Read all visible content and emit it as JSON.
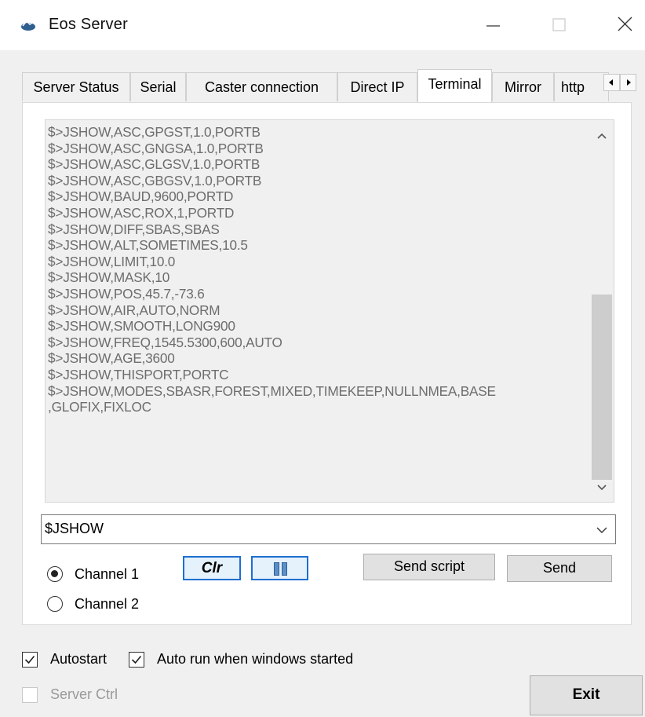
{
  "window": {
    "title": "Eos Server",
    "icon": "eos-app-icon",
    "controls": {
      "minimize": "minimize-icon",
      "maximize": "maximize-icon",
      "close": "close-icon"
    }
  },
  "tabs": [
    {
      "label": "Server Status",
      "active": false
    },
    {
      "label": "Serial",
      "active": false
    },
    {
      "label": "Caster connection",
      "active": false
    },
    {
      "label": "Direct IP",
      "active": false
    },
    {
      "label": "Terminal",
      "active": true
    },
    {
      "label": "Mirror",
      "active": false
    },
    {
      "label": "http",
      "active": false
    }
  ],
  "terminal": {
    "lines": [
      "$>JSHOW,ASC,GPGST,1.0,PORTB",
      "$>JSHOW,ASC,GNGSA,1.0,PORTB",
      "$>JSHOW,ASC,GLGSV,1.0,PORTB",
      "$>JSHOW,ASC,GBGSV,1.0,PORTB",
      "$>JSHOW,BAUD,9600,PORTD",
      "$>JSHOW,ASC,ROX,1,PORTD",
      "$>JSHOW,DIFF,SBAS,SBAS",
      "$>JSHOW,ALT,SOMETIMES,10.5",
      "$>JSHOW,LIMIT,10.0",
      "$>JSHOW,MASK,10",
      "$>JSHOW,POS,45.7,-73.6",
      "$>JSHOW,AIR,AUTO,NORM",
      "$>JSHOW,SMOOTH,LONG900",
      "$>JSHOW,FREQ,1545.5300,600,AUTO",
      "$>JSHOW,AGE,3600",
      "$>JSHOW,THISPORT,PORTC",
      "$>JSHOW,MODES,SBASR,FOREST,MIXED,TIMEKEEP,NULLNMEA,BASE",
      ",GLOFIX,FIXLOC"
    ]
  },
  "command": {
    "value": "$JSHOW"
  },
  "channels": [
    {
      "label": "Channel 1",
      "selected": true
    },
    {
      "label": "Channel 2",
      "selected": false
    }
  ],
  "buttons": {
    "clear": "Clr",
    "pause": "pause-icon",
    "send_script": "Send script",
    "send": "Send",
    "exit": "Exit"
  },
  "options": {
    "autostart": {
      "label": "Autostart",
      "checked": true
    },
    "auto_run": {
      "label": "Auto run when windows started",
      "checked": true
    },
    "server_ctrl": {
      "label": "Server Ctrl",
      "checked": false,
      "disabled": true
    }
  },
  "colors": {
    "focus_border": "#1f6fd0",
    "terminal_text": "#6d6d6d",
    "window_bg": "#f0f0f0"
  }
}
